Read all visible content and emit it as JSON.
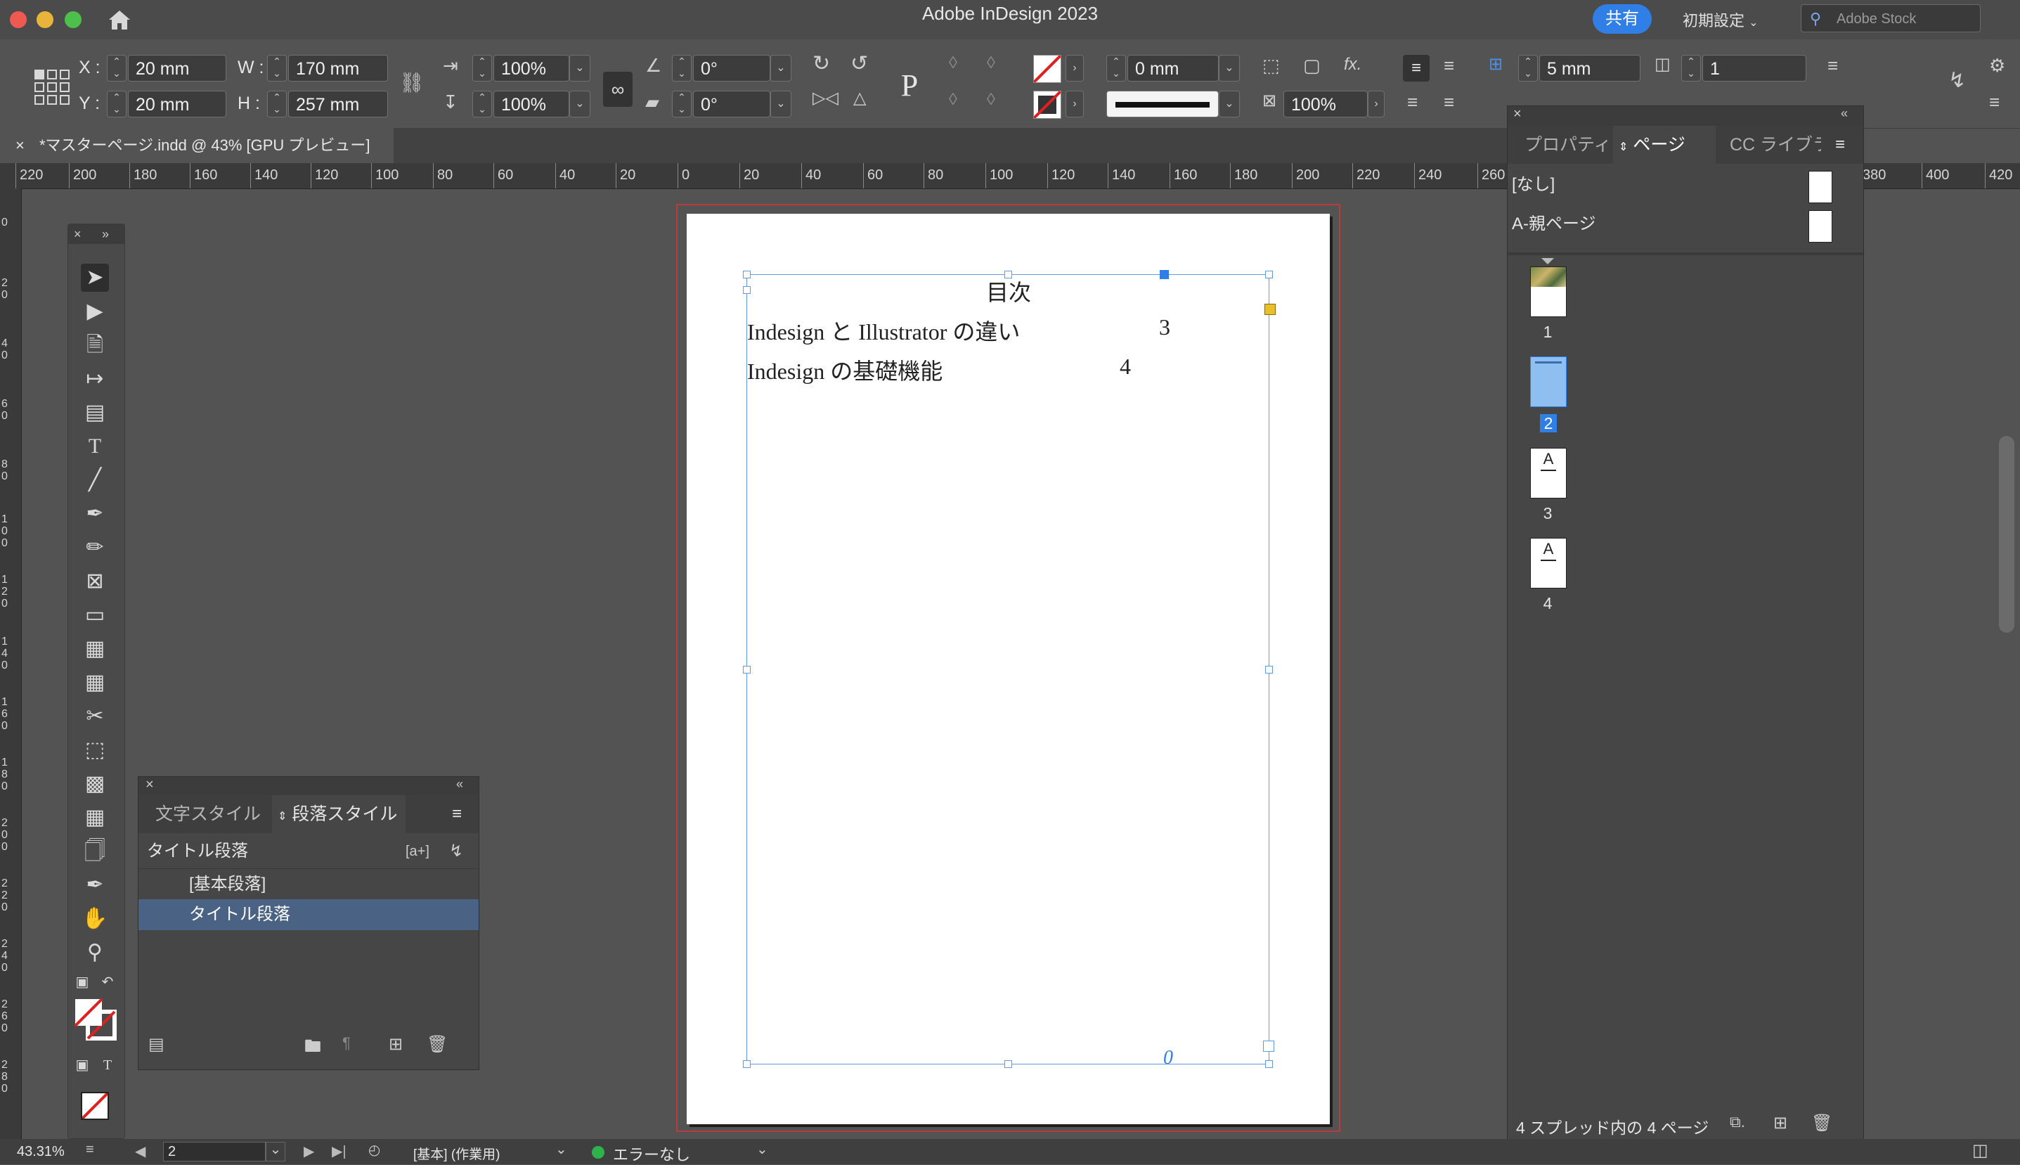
{
  "app": {
    "title": "Adobe InDesign 2023",
    "share_label": "共有",
    "workspace_label": "初期設定",
    "search_placeholder": "Adobe Stock"
  },
  "control": {
    "x_label": "X :",
    "y_label": "Y :",
    "w_label": "W :",
    "h_label": "H :",
    "x_value": "20 mm",
    "y_value": "20 mm",
    "w_value": "170 mm",
    "h_value": "257 mm",
    "scale_x": "100%",
    "scale_y": "100%",
    "rotation": "0°",
    "shear": "0°",
    "stroke_weight": "0 mm",
    "opacity": "100%",
    "gap": "5 mm",
    "gap2": "5 mm",
    "columns": "1"
  },
  "document_tab": {
    "close": "×",
    "label": "*マスターページ.indd @ 43% [GPU プレビュー]"
  },
  "hruler": [
    "220",
    "200",
    "180",
    "160",
    "140",
    "120",
    "100",
    "80",
    "60",
    "40",
    "20",
    "0",
    "20",
    "40",
    "60",
    "80",
    "100",
    "120",
    "140",
    "160",
    "180",
    "200",
    "220",
    "240",
    "260",
    "380",
    "400",
    "420"
  ],
  "vruler": [
    "0",
    "20",
    "40",
    "60",
    "80",
    "100",
    "120",
    "140",
    "160",
    "180",
    "200",
    "220",
    "240",
    "260",
    "280"
  ],
  "page": {
    "toc_title": "目次",
    "entries": [
      {
        "text": "Indesign と Illustrator の違い",
        "page": "3"
      },
      {
        "text": "Indesign の基礎機能",
        "page": "4"
      }
    ],
    "overset_mark": "0"
  },
  "style_panel": {
    "tab_char": "文字スタイル",
    "tab_para": "段落スタイル",
    "current": "タイトル段落",
    "items": [
      "[基本段落]",
      "タイトル段落"
    ],
    "selected_color": "#4a6283"
  },
  "pages_panel": {
    "tab_properties": "プロパティ",
    "tab_pages": "ページ",
    "tab_cc": "CC ライブラ",
    "masters": [
      "[なし]",
      "A-親ページ"
    ],
    "pages": [
      "1",
      "2",
      "3",
      "4"
    ],
    "master_letter": "A",
    "footer": "4 スプレッド内の 4 ページ"
  },
  "status": {
    "zoom": "43.31%",
    "page_field": "2",
    "profile": "[基本] (作業用)",
    "preflight": "エラーなし",
    "preflight_color": "#2fb24c"
  },
  "colors": {
    "accent": "#2f7fe6",
    "frame": "#5e9ce6",
    "bleed": "#b83c3c"
  }
}
